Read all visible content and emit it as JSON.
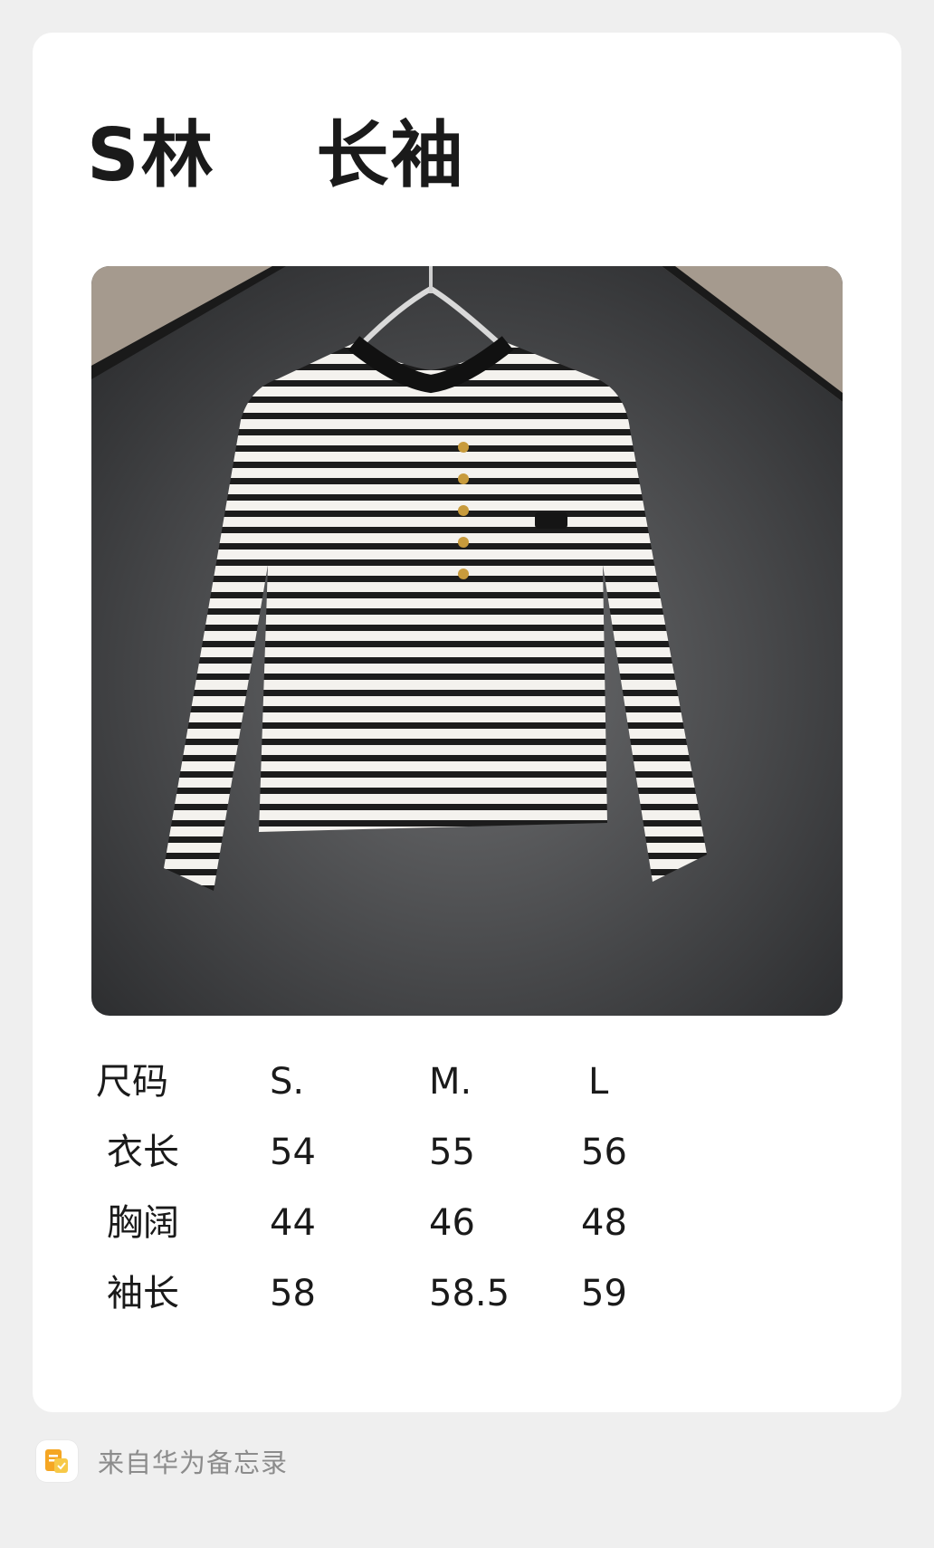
{
  "note": {
    "title": "S林　 长袖",
    "product_image": "striped-long-sleeve-knit-top"
  },
  "size_chart": {
    "header": [
      "尺码",
      "S.",
      "M.",
      "L"
    ],
    "rows": [
      [
        "衣长",
        "54",
        "55",
        "56"
      ],
      [
        "胸阔",
        "44",
        "46",
        "48"
      ],
      [
        "袖长",
        "58",
        "58.5",
        "59"
      ]
    ]
  },
  "footer": {
    "icon": "huawei-notes-icon",
    "text": "来自华为备忘录"
  },
  "colors": {
    "background": "#efefef",
    "card": "#ffffff",
    "footer_text": "#8c8c8c",
    "notes_icon_orange": "#f5a623"
  }
}
